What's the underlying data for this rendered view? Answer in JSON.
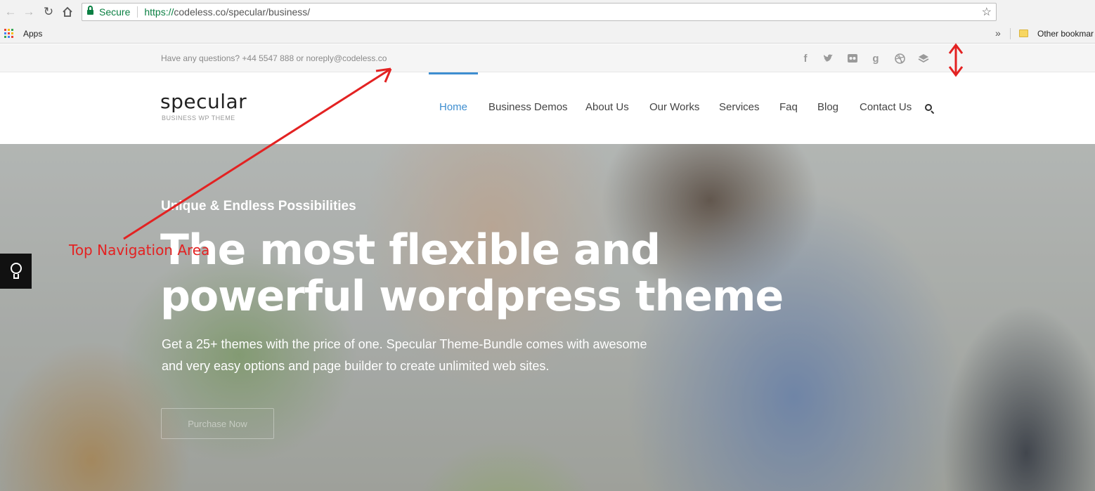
{
  "browser": {
    "secure_label": "Secure",
    "url_scheme": "https://",
    "url_rest": "codeless.co/specular/business/",
    "bookmarks": {
      "apps_label": "Apps",
      "other_label": "Other bookmar"
    }
  },
  "topbar": {
    "contact_text": "Have any questions? +44 5547 888 or noreply@codeless.co",
    "social_icons": [
      "facebook-icon",
      "twitter-icon",
      "flickr-icon",
      "google-icon",
      "dribbble-icon",
      "layers-icon"
    ]
  },
  "header": {
    "logo": "specular",
    "logo_sub": "BUSINESS WP THEME",
    "menu": [
      "Home",
      "Business Demos",
      "About Us",
      "Our Works",
      "Services",
      "Faq",
      "Blog",
      "Contact Us"
    ],
    "active_index": 0
  },
  "hero": {
    "kicker": "Unique & Endless Possibilities",
    "title": "The most flexible and powerful wordpress theme",
    "description": "Get a 25+ themes with the price of one. Specular Theme-Bundle comes with awesome and very easy options and page builder to create unlimited web sites.",
    "cta": "Purchase Now"
  },
  "annotation": {
    "label": "Top Navigation Area",
    "color": "#e32222"
  },
  "colors": {
    "accent": "#3e8ed0",
    "secure_green": "#0b8043"
  }
}
